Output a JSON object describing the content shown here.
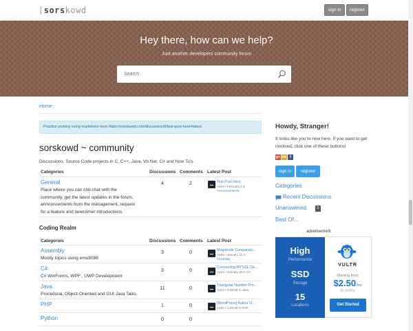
{
  "topbar": {
    "logo_bracket": "[",
    "logo_main": "sors",
    "logo_rest": "kowd",
    "signin": "sign in",
    "register": "register"
  },
  "hero": {
    "title": "Hey there, how can we help?",
    "subtitle": "Just another developers community forum",
    "search_placeholder": "Search"
  },
  "breadcrumb": "Home",
  "alert": {
    "text": "Practice posting using markdown here ",
    "link": "https://sorskowd.com/discussion/8/test-post-here#latest"
  },
  "main": {
    "title": "sorskowd ~ community",
    "description": "Discussions, Source Code projects in C, C++, Java, Vb.Net, C# and How To's."
  },
  "columns": {
    "categories": "Categories",
    "discussions": "Discussions",
    "comments": "Comments",
    "latest": "Latest Post"
  },
  "general": {
    "name": "General",
    "description": "Place where you can chit-chat with the community, get the latest updates in the forum, announcements from the management, request for a feature and newcomer introductions.",
    "discussions": "4",
    "comments": "2",
    "latest_title": "Test Post Here",
    "latest_meta_1": "Yoshi • February 3 in",
    "latest_meta_2": "Announcements"
  },
  "coding_realm": {
    "title": "Coding Realm",
    "rows": [
      {
        "name": "Assembly",
        "description": "Mostly topics using emu8086",
        "discussions": "3",
        "comments": "0",
        "latest_title": "Magnitude Comparato...",
        "latest_meta_1": "Yoshi • January 31 in",
        "latest_meta_2": "Assembly"
      },
      {
        "name": "C#",
        "description": "C# WinForms, WPF , UWP Development",
        "discussions": "3",
        "comments": "0",
        "latest_title": "Connecting MYSQL Da...",
        "latest_meta_1": "Yoshi • January 30 in C#",
        "latest_meta_2": ""
      },
      {
        "name": "Java",
        "description": "Procedural, Object-Oriented and GUI Java Talks",
        "discussions": "11",
        "comments": "0",
        "latest_title": "Triangular Number Pro...",
        "latest_meta_1": "Yoshi • 2:06AM in Java",
        "latest_meta_2": ""
      },
      {
        "name": "PHP",
        "description": "",
        "discussions": "1",
        "comments": "0",
        "latest_title": "[WordPress] Author G...",
        "latest_meta_1": "Yoshi • 1:24AM in PHP",
        "latest_meta_2": ""
      },
      {
        "name": "Python",
        "description": "",
        "discussions": "0",
        "comments": "0",
        "latest_title": "",
        "latest_meta_1": "",
        "latest_meta_2": ""
      }
    ]
  },
  "sidebar": {
    "howdy": "Howdy, Stranger!",
    "intro": "It looks like you're new here. If you want to get involved, click one of these buttons!",
    "social": [
      "g+",
      "ok",
      "f"
    ],
    "signin": "sign in",
    "register": "register",
    "links": {
      "categories": "Categories",
      "recent": "Recent Discussions",
      "unanswered": "Unanswered",
      "unanswered_count": "0",
      "best": "Best Of..."
    },
    "advertisement": "advetisement"
  },
  "ad": {
    "high": "High",
    "performance": "Performance",
    "ssd": "SSD",
    "storage": "Storage",
    "locations_num": "15",
    "locations": "Locations",
    "brand": "VULTR",
    "starting": "Starting from",
    "price": "$2.50",
    "per_month": "/mo",
    "per_hour": "$0.004/hr",
    "cta": "Get Started"
  },
  "colors": {
    "link": "#3a87c8",
    "hero_bg": "#8a6352",
    "button_blue": "#3aa0e6",
    "ad_blue": "#1a5fb4"
  }
}
